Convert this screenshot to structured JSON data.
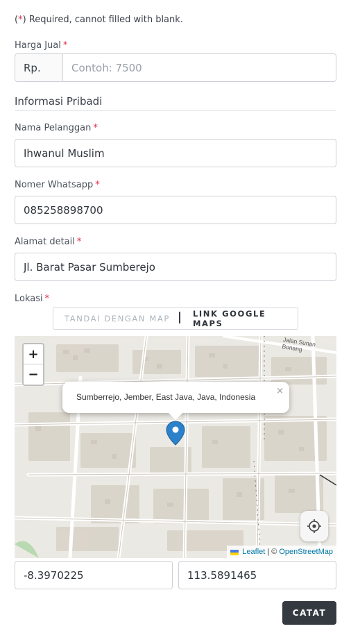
{
  "note": {
    "open": "(",
    "asterisk": "*",
    "text": ") Required, cannot filled with blank."
  },
  "price": {
    "label": "Harga Jual",
    "required_mark": "*",
    "prefix": "Rp.",
    "placeholder": "Contoh: 7500",
    "value": ""
  },
  "section": {
    "title": "Informasi Pribadi"
  },
  "customer": {
    "label": "Nama Pelanggan",
    "required_mark": "*",
    "value": "Ihwanul Muslim"
  },
  "whatsapp": {
    "label": "Nomer Whatsapp",
    "required_mark": "*",
    "value": "085258898700"
  },
  "address": {
    "label": "Alamat detail",
    "required_mark": "*",
    "value": "Jl. Barat Pasar Sumberejo"
  },
  "location": {
    "label": "Lokasi",
    "required_mark": "*",
    "toggle": {
      "option_map": "Tandai dengan map",
      "option_link": "Link Google Maps",
      "active": "option_link"
    }
  },
  "map": {
    "zoom_in": "+",
    "zoom_out": "−",
    "street_label": "Jalan Sunan Bonang",
    "popup_text": "Sumberrejo, Jember, East Java, Java, Indonesia",
    "popup_close": "×",
    "attribution": {
      "leaflet": "Leaflet",
      "separator": "| ©",
      "osm": "OpenStreetMap"
    },
    "marker_color": "#2b82cb"
  },
  "coords": {
    "latitude": "-8.3970225",
    "longitude": "113.5891465"
  },
  "submit": {
    "label": "CATAT"
  },
  "colors": {
    "required": "#e0304a",
    "button": "#343a40",
    "link": "#0078a8"
  }
}
